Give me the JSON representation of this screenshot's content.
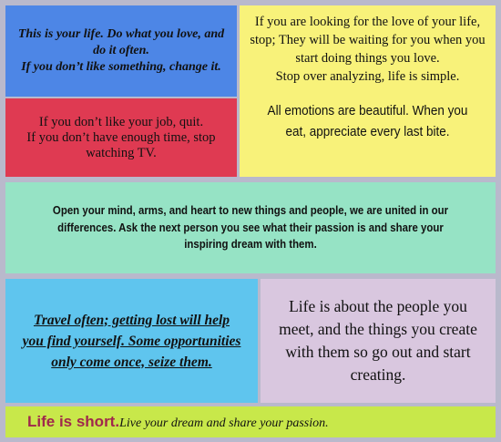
{
  "panels": {
    "blue": {
      "line1": "This is your life. Do what you love, and do it often.",
      "line2": "If you don’t like something, change it."
    },
    "red": {
      "line1": "If you don’t like your job, quit.",
      "line2": "If you don’t have enough time, stop watching TV."
    },
    "yellow": {
      "para1": "If you are looking for the love of your life, stop; They will be waiting for you when you start doing things you love.",
      "para1b": "Stop over analyzing, life is simple.",
      "para2": "All emotions are beautiful. When you eat, appreciate every last bite."
    },
    "mint": {
      "text": "Open your mind, arms, and heart to new things and people, we are united in our differences. Ask the next person you see what their passion is and share your inspiring dream with them."
    },
    "sky": {
      "text": "Travel often; getting lost will help you find yourself. Some opportunities only come once, seize them."
    },
    "lavender": {
      "text": "Life is about the people you meet, and the things you create with them so go out and start creating."
    },
    "banner": {
      "lead": "Life is short.",
      "rest": "Live your dream and share your passion."
    }
  },
  "colors": {
    "background": "#b9b9cc",
    "blue": "#4d86e6",
    "red": "#df3a52",
    "yellow": "#f8f27a",
    "mint": "#96e3c5",
    "sky": "#5fc5ee",
    "lavender": "#d9c7df",
    "green": "#c8e84a",
    "banner_lead": "#a0284c"
  }
}
